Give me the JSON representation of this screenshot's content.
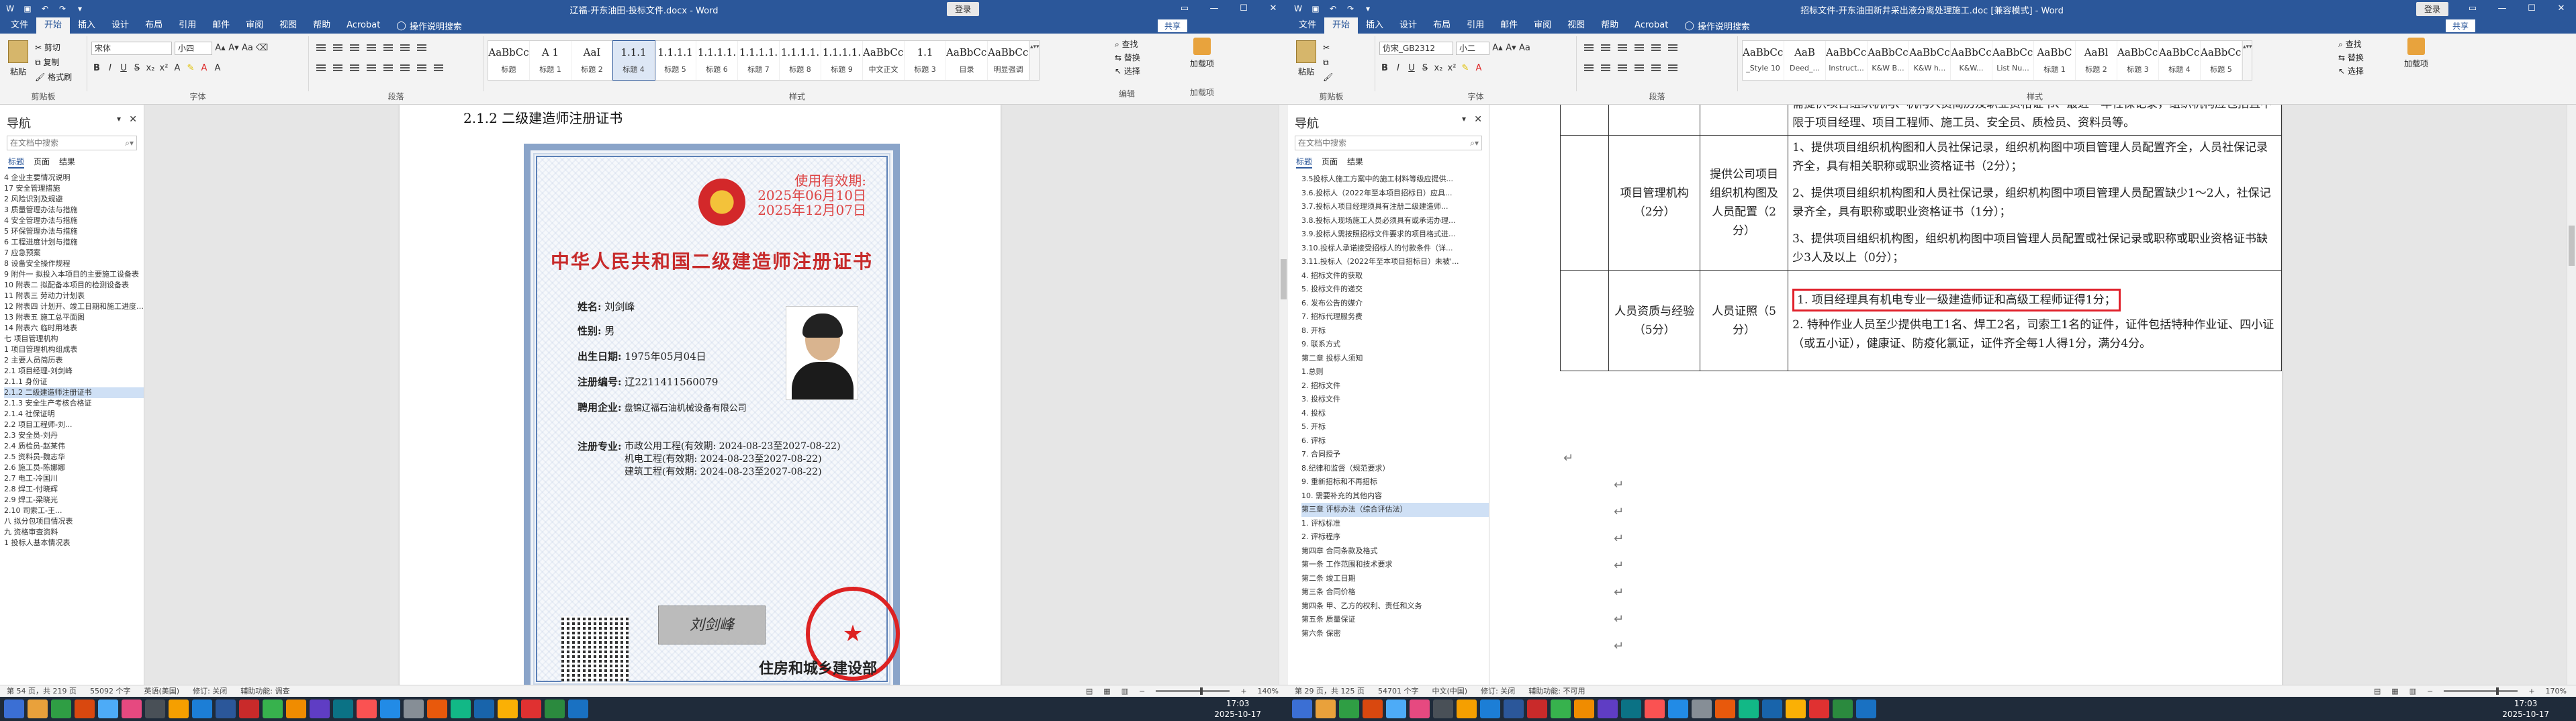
{
  "colors": {
    "accent": "#2b579a",
    "status_highlight": "#e0202a",
    "taskbar": "#1f2b3a"
  },
  "left": {
    "titlebar": {
      "title": "辽福-开东油田-投标文件.docx - Word",
      "login": "登录"
    },
    "tabs": [
      "文件",
      "开始",
      "插入",
      "设计",
      "布局",
      "引用",
      "邮件",
      "审阅",
      "视图",
      "帮助",
      "Acrobat"
    ],
    "active_tab": "开始",
    "tell_me": "操作说明搜索",
    "share": "共享",
    "clipboard": {
      "paste": "粘贴",
      "cut": "剪切",
      "copy": "复制",
      "format_painter": "格式刷",
      "group": "剪贴板"
    },
    "font": {
      "family": "宋体",
      "size": "小四",
      "group": "字体"
    },
    "paragraph_group": "段落",
    "styles": {
      "group": "样式",
      "items": [
        {
          "preview": "AaBbCc",
          "name": "标题"
        },
        {
          "preview": "A 1",
          "name": "标题 1"
        },
        {
          "preview": "AaI",
          "name": "标题 2"
        },
        {
          "preview": "1.1.1",
          "name": "标题 4"
        },
        {
          "preview": "1.1.1.1",
          "name": "标题 5"
        },
        {
          "preview": "1.1.1.1.",
          "name": "标题 6"
        },
        {
          "preview": "1.1.1.1.",
          "name": "标题 7"
        },
        {
          "preview": "1.1.1.1.",
          "name": "标题 8"
        },
        {
          "preview": "1.1.1.1.",
          "name": "标题 9"
        },
        {
          "preview": "AaBbCcDd",
          "name": "中文正文"
        },
        {
          "preview": "1.1",
          "name": "标题 3"
        },
        {
          "preview": "AaBbCcDc",
          "name": "目录"
        },
        {
          "preview": "AaBbCcDc",
          "name": "明显强调"
        }
      ]
    },
    "editing": {
      "find": "查找",
      "replace": "替换",
      "select": "选择",
      "group": "编辑"
    },
    "addin": {
      "label": "加载项",
      "group": "加载项"
    },
    "nav": {
      "title": "导航",
      "search_placeholder": "在文档中搜索",
      "tabs": [
        "标题",
        "页面",
        "结果"
      ],
      "items": [
        "4 企业主要情况说明",
        "17 安全管理措施",
        "2 风险识别及规避",
        "3 质量管理办法与措施",
        "4 安全管理办法与措施",
        "5 环保管理办法与措施",
        "6 工程进度计划与措施",
        "7 应急预案",
        "8 设备安全操作规程",
        "9 附件一 拟投入本项目的主要施工设备表",
        "10 附表二 拟配备本项目的检测设备表",
        "11 附表三 劳动力计划表",
        "12 附表四 计划开、竣工日期和施工进度网络图",
        "13 附表五 施工总平面图",
        "14 附表六 临时用地表",
        "七 项目管理机构",
        "1 项目管理机构组成表",
        "2 主要人员简历表",
        "2.1 项目经理-刘剑峰",
        "2.1.1 身份证",
        "2.1.2 二级建造师注册证书",
        "2.1.3 安全生产考核合格证",
        "2.1.4 社保证明",
        "2.2 项目工程师-刘...",
        "2.3 安全员-刘丹",
        "2.4 质检员-赵某伟",
        "2.5 资料员-魏志华",
        "2.6 施工员-陈娜娜",
        "2.7 电工-冷国川",
        "2.8 焊工-付晓辉",
        "2.9 焊工-梁晓光",
        "2.10 司索工-王...",
        "八 拟分包项目情况表",
        "九 资格审查资料",
        "1 投标人基本情况表"
      ],
      "current": "2.1.2 二级建造师注册证书"
    },
    "heading": "2.1.2 二级建造师注册证书",
    "cert": {
      "valid_label": "使用有效期:",
      "valid_from": "2025年06月10日",
      "valid_to": "2025年12月07日",
      "title": "中华人民共和国二级建造师注册证书",
      "name_label": "姓名:",
      "name": "刘剑峰",
      "gender_label": "性别:",
      "gender": "男",
      "birth_label": "出生日期:",
      "birth": "1975年05月04日",
      "reg_label": "注册编号:",
      "reg_no": "辽2211411560079",
      "employer_label": "聘用企业:",
      "employer": "盘锦辽福石油机械设备有限公司",
      "spec_label": "注册专业:",
      "specialties": [
        "市政公用工程(有效期: 2024-08-23至2027-08-22)",
        "机电工程(有效期: 2024-08-23至2027-08-22)",
        "建筑工程(有效期: 2024-08-23至2027-08-22)"
      ],
      "signature": "刘剑峰",
      "issuer": "住房和城乡建设部",
      "seal_text": "中华人民共和国住房和城乡建设部"
    },
    "status": {
      "page": "第 54 页，共 219 页",
      "words": "55092 个字",
      "lang": "英语(美国)",
      "track": "修订: 关闭",
      "access": "辅助功能: 调查",
      "zoom": "140%"
    }
  },
  "right": {
    "titlebar": {
      "title": "招标文件-开东油田新井采出液分离处理施工.doc [兼容模式] - Word",
      "login": "登录"
    },
    "tabs": [
      "文件",
      "开始",
      "插入",
      "设计",
      "布局",
      "引用",
      "邮件",
      "审阅",
      "视图",
      "帮助",
      "Acrobat"
    ],
    "active_tab": "开始",
    "tell_me": "操作说明搜索",
    "share": "共享",
    "font": {
      "family": "仿宋_GB2312",
      "size": "小二"
    },
    "styles": {
      "items": [
        {
          "preview": "AaBbCcDc",
          "name": "_Style 10"
        },
        {
          "preview": "AaB",
          "name": "Deed_..."
        },
        {
          "preview": "AaBbCcDdE",
          "name": "Instruct..."
        },
        {
          "preview": "AaBbCc",
          "name": "K&W B..."
        },
        {
          "preview": "AaBbCc",
          "name": "K&W h..."
        },
        {
          "preview": "AaBbCc",
          "name": "K&W..."
        },
        {
          "preview": "AaBbCcI",
          "name": "List Nu..."
        },
        {
          "preview": "AaBbC",
          "name": "标题 1"
        },
        {
          "preview": "AaBl",
          "name": "标题 2"
        },
        {
          "preview": "AaBbCcI",
          "name": "标题 3"
        },
        {
          "preview": "AaBbCcD",
          "name": "标题 4"
        },
        {
          "preview": "AaBbCcD",
          "name": "标题 5"
        }
      ]
    },
    "nav": {
      "title": "导航",
      "search_placeholder": "在文档中搜索",
      "tabs": [
        "标题",
        "页面",
        "结果"
      ],
      "items": [
        "3.5投标人施工方案中的施工材料等级应提供...",
        "3.6.投标人（2022年至本项目招标日）应具...",
        "3.7.投标人项目经理须具有注册二级建造师...",
        "3.8.投标人现场施工人员必须具有或承诺办理...",
        "3.9.投标人需按照招标文件要求的项目格式进...",
        "3.10.投标人承诺接受招标人的付款条件（详...",
        "3.11.投标人（2022年至本项目招标日）未被'...",
        "4. 招标文件的获取",
        "5. 投标文件的递交",
        "6. 发布公告的媒介",
        "7. 招标代理服务费",
        "8. 开标",
        "9. 联系方式",
        "第二章 投标人须知",
        "1.总则",
        "2. 招标文件",
        "3. 投标文件",
        "4. 投标",
        "5. 开标",
        "6. 评标",
        "7. 合同授予",
        "8.纪律和监督（规范要求）",
        "9. 重新招标和不再招标",
        "10. 需要补充的其他内容",
        "第三章 评标办法（综合评估法）",
        "1. 评标标准",
        "2. 评标程序",
        "第四章 合同条款及格式",
        "第一条 工作范围和技术要求",
        "第二条 竣工日期",
        "第三条 合同价格",
        "第四条 甲、乙方的权利、责任和义务",
        "第五条 质量保证",
        "第六条 保密"
      ],
      "current": "第三章 评标办法（综合评估法）"
    },
    "table": {
      "top_text": "需提供项目组织机构、机构人员简历及职业资格证书、最近一年社保记录，组织机构应包括且不限于项目经理、项目工程师、施工员、安全员、质检员、资料员等。",
      "rows": [
        {
          "cat": "项目管理机构（2分）",
          "item": "提供公司项目组织机构图及人员配置（2分）",
          "lines": [
            "1、提供项目组织机构图和人员社保记录，组织机构图中项目管理人员配置齐全，人员社保记录齐全，具有相关职称或职业资格证书（2分）；",
            "2、提供项目组织机构图和人员社保记录，组织机构图中项目管理人员配置缺少1～2人，社保记录齐全，具有职称或职业资格证书（1分）；",
            "3、提供项目组织机构图，组织机构图中项目管理人员配置或社保记录或职称或职业资格证书缺少3人及以上（0分）；"
          ]
        },
        {
          "cat": "人员资质与经验（5分）",
          "item": "人员证照（5分）",
          "lines": [
            "1. 项目经理具有机电专业一级建造师证和高级工程师证得1分；",
            "2. 特种作业人员至少提供电工1名、焊工2名，司索工1名的证件，证件包括特种作业证、四小证（或五小证），健康证、防疫化氯证，证件齐全每1人得1分，满分4分。"
          ]
        }
      ]
    },
    "status": {
      "page": "第 29 页，共 125 页",
      "words": "54701 个字",
      "lang": "中文(中国)",
      "track": "修订: 关闭",
      "access": "辅助功能: 不可用",
      "zoom": "170%"
    }
  },
  "taskbar": {
    "time": "17:03",
    "date": "2025-10-17"
  }
}
